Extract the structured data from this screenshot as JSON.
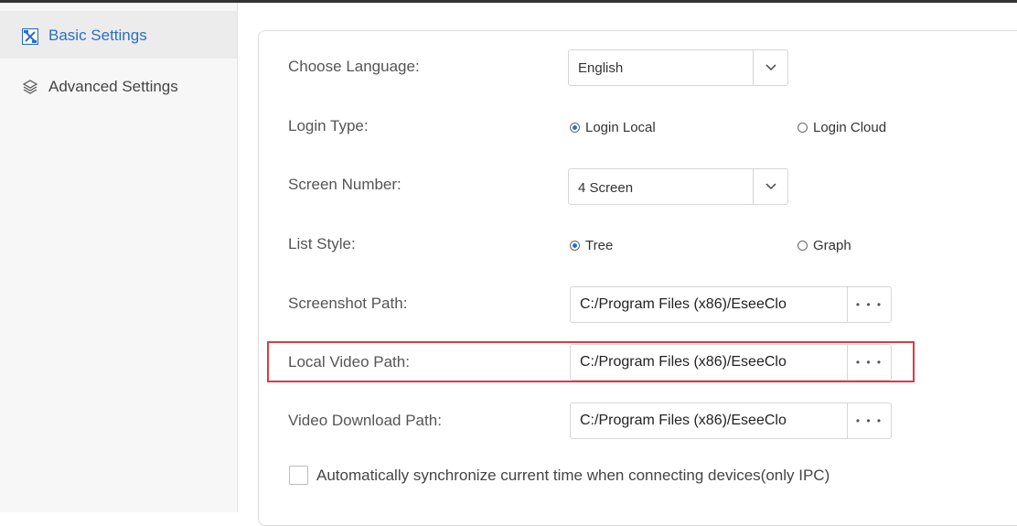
{
  "sidebar": {
    "items": [
      {
        "label": "Basic Settings",
        "icon": "tools-icon",
        "active": true
      },
      {
        "label": "Advanced Settings",
        "icon": "layers-icon",
        "active": false
      }
    ]
  },
  "settings": {
    "language": {
      "label": "Choose Language:",
      "value": "English"
    },
    "login_type": {
      "label": "Login Type:",
      "options": [
        "Login Local",
        "Login Cloud"
      ],
      "selected": "Login Local"
    },
    "screen_number": {
      "label": "Screen Number:",
      "value": "4 Screen"
    },
    "list_style": {
      "label": "List Style:",
      "options": [
        "Tree",
        "Graph"
      ],
      "selected": "Tree"
    },
    "screenshot_path": {
      "label": "Screenshot Path:",
      "value": "C:/Program Files (x86)/EseeClo",
      "browse": "• • •"
    },
    "local_video_path": {
      "label": "Local Video Path:",
      "value": "C:/Program Files (x86)/EseeClo",
      "browse": "• • •"
    },
    "video_download_path": {
      "label": "Video Download Path:",
      "value": "C:/Program Files (x86)/EseeClo",
      "browse": "• • •"
    },
    "auto_sync": {
      "label": "Automatically synchronize current time when connecting devices(only IPC)",
      "checked": false
    }
  },
  "colors": {
    "accent": "#2a6fc4",
    "highlight": "#e0393e"
  }
}
